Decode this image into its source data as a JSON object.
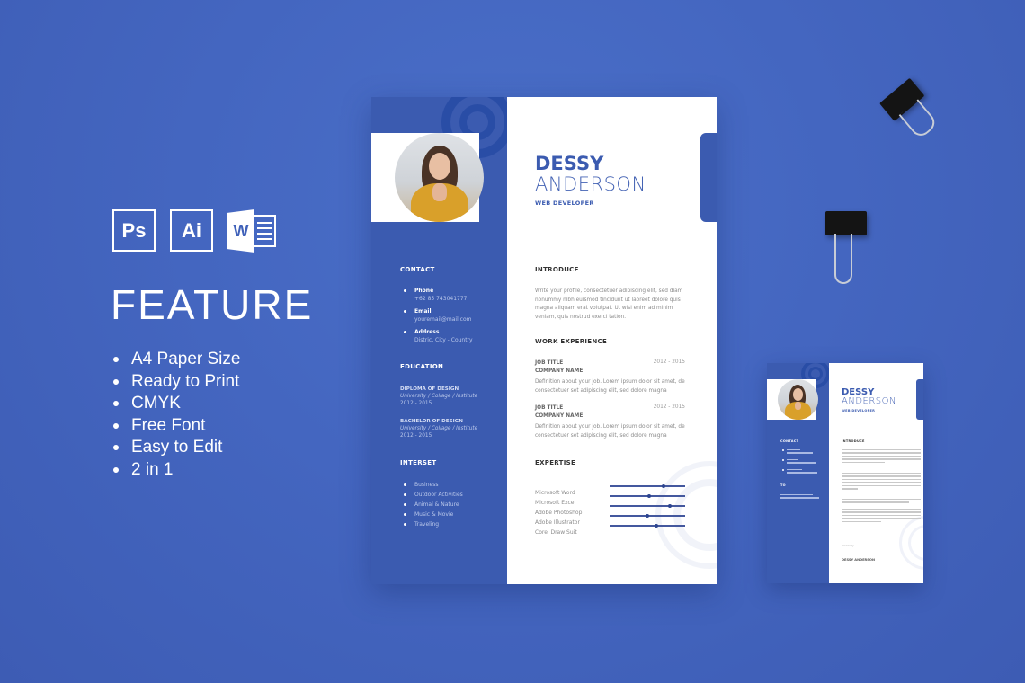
{
  "feature_panel": {
    "app_icons": [
      {
        "name": "photoshop-icon",
        "label": "Ps"
      },
      {
        "name": "illustrator-icon",
        "label": "Ai"
      },
      {
        "name": "word-icon",
        "label": "W"
      }
    ],
    "title": "FEATURE",
    "items": [
      "A4 Paper Size",
      "Ready to Print",
      "CMYK",
      "Free Font",
      "Easy to Edit",
      "2 in 1"
    ]
  },
  "resume": {
    "first_name": "DESSY",
    "last_name": "ANDERSON",
    "role": "WEB DEVELOPER",
    "contact": {
      "heading": "CONTACT",
      "items": [
        {
          "label": "Phone",
          "value": "+62 85 743041777"
        },
        {
          "label": "Email",
          "value": "youremail@mail.com"
        },
        {
          "label": "Address",
          "value": "Distric, City - Country"
        }
      ]
    },
    "education": {
      "heading": "EDUCATION",
      "items": [
        {
          "degree": "DIPLOMA OF DESIGN",
          "school": "University / Collage / Institute",
          "years": "2012 - 2015"
        },
        {
          "degree": "BACHELOR OF DESIGN",
          "school": "University / Collage / Institute",
          "years": "2012 - 2015"
        }
      ]
    },
    "interest": {
      "heading": "INTERSET",
      "items": [
        "Business",
        "Outdoor Activities",
        "Animal & Nature",
        "Music & Movie",
        "Traveling"
      ]
    },
    "introduce": {
      "heading": "INTRODUCE",
      "text": "Write your profile, consectetuer adipiscing elit, sed diam nonummy nibh euismod tincidunt ut laoreet dolore quis magna aliquam erat volutpat. Ut wisi enim ad minim veniam, quis nostrud exerci tation."
    },
    "work": {
      "heading": "WORK EXPERIENCE",
      "items": [
        {
          "title": "JOB TITLE",
          "company": "COMPANY NAME",
          "years": "2012 - 2015",
          "description": "Definition about your job. Lorem ipsum dolor sit amet, de consectetuer set adipiscing elit, sed dolore magna"
        },
        {
          "title": "JOB TITLE",
          "company": "COMPANY NAME",
          "years": "2012 - 2015",
          "description": "Definition about your job. Lorem ipsum dolor sit amet, de consectetuer set adipiscing elit, sed dolore magna"
        }
      ]
    },
    "expertise": {
      "heading": "EXPERTISE",
      "items": [
        {
          "name": "Microsoft Word",
          "level": 0.72
        },
        {
          "name": "Microsoft Excel",
          "level": 0.52
        },
        {
          "name": "Adobe Photoshop",
          "level": 0.8
        },
        {
          "name": "Adobe Illustrator",
          "level": 0.5
        },
        {
          "name": "Corel Draw Suit",
          "level": 0.62
        }
      ]
    }
  },
  "mini_resume": {
    "first_name": "DESSY",
    "last_name": "ANDERSON",
    "role": "WEB DEVELOPER",
    "contact_heading": "CONTACT",
    "to_heading": "TO",
    "introduce_heading": "INTRODUCE",
    "signature_label": "Sincerely",
    "signature_name": "DESSY ANDERSON"
  },
  "colors": {
    "background": "#4466c0",
    "sidebar": "#3b5bb0",
    "accent": "#3b5bb0",
    "paper": "#ffffff"
  }
}
